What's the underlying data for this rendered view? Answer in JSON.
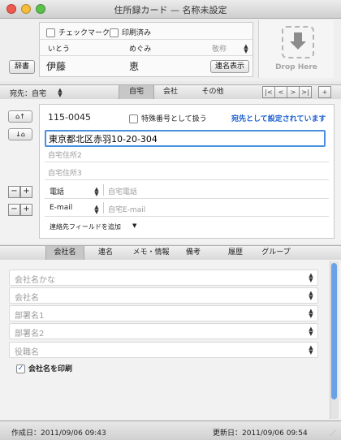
{
  "window": {
    "title": "住所録カード — 名称未設定"
  },
  "header": {
    "check_mark_label": "チェックマーク",
    "printed_label": "印刷済み",
    "last_kana": "いとう",
    "first_kana": "めぐみ",
    "honorific": "敬称",
    "last_name": "伊藤",
    "first_name": "恵",
    "dictionary_button": "辞書",
    "joint_name_button": "連名表示",
    "drop_here": "Drop Here"
  },
  "address_bar": {
    "destination_label": "宛先：自宅",
    "tabs": [
      "自宅",
      "会社",
      "その他"
    ],
    "selected_tab": "自宅",
    "nav_first": "|<",
    "nav_prev": "<",
    "nav_next": ">",
    "nav_last": ">|",
    "nav_add": "+"
  },
  "address": {
    "postal_code": "115-0045",
    "special_number_label": "特殊番号として扱う",
    "destination_status": "宛先として設定されています",
    "address1": "東京都北区赤羽10-20-304",
    "address2_placeholder": "自宅住所2",
    "address3_placeholder": "自宅住所3",
    "phone_type": "電話",
    "phone_placeholder": "自宅電話",
    "email_type": "E-mail",
    "email_placeholder": "自宅E-mail",
    "add_field_label": "連絡先フィールドを追加",
    "minus": "−",
    "plus": "+"
  },
  "bottom_tabs": {
    "items": [
      "会社名",
      "連名",
      "メモ・情報",
      "備考",
      "履歴",
      "グループ"
    ],
    "selected": "会社名"
  },
  "company": {
    "company_kana_placeholder": "会社名かな",
    "company_name_placeholder": "会社名",
    "department1_placeholder": "部署名1",
    "department2_placeholder": "部署名2",
    "title_placeholder": "役職名",
    "print_company_label": "会社名を印刷",
    "print_company_checked": true
  },
  "status": {
    "created": "作成日：2011/09/06 09:43",
    "updated": "更新日：2011/09/06 09:54"
  },
  "colors": {
    "accent_link": "#1d5fd0",
    "focus_ring": "#4a8fe0",
    "scrollbar": "#6aa2e8"
  }
}
